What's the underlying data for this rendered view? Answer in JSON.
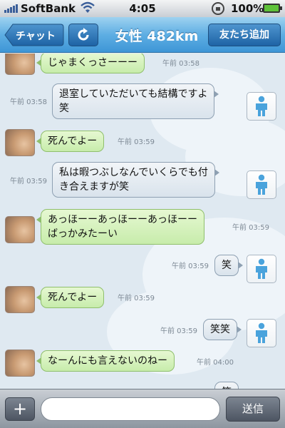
{
  "status_bar": {
    "carrier": "SoftBank",
    "time": "4:05",
    "battery": "100%"
  },
  "nav": {
    "back_label": "チャット",
    "title": "女性 482km",
    "add_friend_label": "友たち追加"
  },
  "messages": [
    {
      "from": "partner",
      "text": "じゃまくっさーーー",
      "time": "午前 03:58"
    },
    {
      "from": "me",
      "lines": [
        "退室していただいても結構ですよ",
        "笑"
      ],
      "time": "午前 03:58"
    },
    {
      "from": "partner",
      "text": "死んでよー",
      "time": "午前 03:59"
    },
    {
      "from": "me",
      "lines": [
        "私は暇つぶしなんでいくらでも付",
        "き合えますが笑"
      ],
      "time": "午前 03:59"
    },
    {
      "from": "partner",
      "lines": [
        "あっほーーあっほーーあっほーー",
        "ばっかみたーい"
      ],
      "time": "午前 03:59"
    },
    {
      "from": "me",
      "text": "笑",
      "time": "午前 03:59"
    },
    {
      "from": "partner",
      "text": "死んでよー",
      "time": "午前 03:59"
    },
    {
      "from": "me",
      "text": "笑笑",
      "time": "午前 03:59"
    },
    {
      "from": "partner",
      "text": "なーんにも言えないのねー",
      "time": "午前 04:00"
    },
    {
      "from": "me",
      "text": "笑",
      "time": ""
    }
  ],
  "input_bar": {
    "message_value": "",
    "send_label": "送信",
    "plus_label": "+"
  },
  "colors": {
    "nav_blue": "#5eaee3",
    "partner_bubble": "#c7ecab",
    "my_bubble": "#d9e3ec",
    "chat_background": "#dfe9f1"
  },
  "icons": {
    "refresh": "refresh-icon",
    "person": "person-icon",
    "signal": "signal-icon",
    "wifi": "wifi-icon",
    "lock": "rotation-lock-icon",
    "battery": "battery-icon"
  }
}
